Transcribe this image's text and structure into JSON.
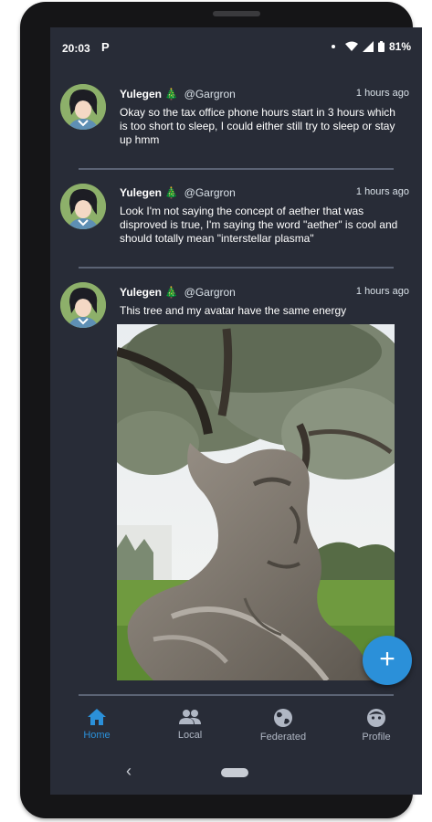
{
  "status_bar": {
    "time": "20:03",
    "notification_icon": "P",
    "battery": "81%"
  },
  "posts": [
    {
      "display_name": "Yulegen 🎄",
      "acct": "@Gargron",
      "time": "1 hours ago",
      "text": "Okay so the tax office phone hours start in 3 hours which is too short to sleep, I could either still try to sleep or stay up hmm"
    },
    {
      "display_name": "Yulegen 🎄",
      "acct": "@Gargron",
      "time": "1 hours ago",
      "text": "Look I'm not saying the concept of aether that was disproved is true, I'm saying the word \"aether\" is cool and should totally mean \"interstellar plasma\""
    },
    {
      "display_name": "Yulegen 🎄",
      "acct": "@Gargron",
      "time": "1 hours ago",
      "text": "This tree and my avatar have the same energy"
    }
  ],
  "fab": {
    "label": "+"
  },
  "bottom_nav": [
    {
      "label": "Home",
      "icon": "home-icon",
      "active": true
    },
    {
      "label": "Local",
      "icon": "people-icon",
      "active": false
    },
    {
      "label": "Federated",
      "icon": "globe-icon",
      "active": false
    },
    {
      "label": "Profile",
      "icon": "face-icon",
      "active": false
    }
  ],
  "colors": {
    "background": "#282c37",
    "accent": "#2b90d9",
    "divider": "#5b6374"
  }
}
